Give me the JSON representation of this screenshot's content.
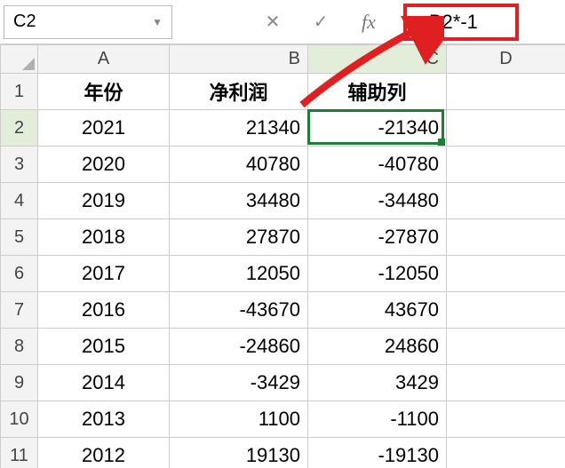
{
  "formulaBar": {
    "nameBox": "C2",
    "cancelIcon": "✕",
    "acceptIcon": "✓",
    "fxLabel": "fx",
    "formula": "=B2*-1"
  },
  "columns": [
    "A",
    "B",
    "C",
    "D"
  ],
  "headerRow": {
    "A": "年份",
    "B": "净利润",
    "C": "辅助列"
  },
  "rows": [
    {
      "n": "1",
      "A": "年份",
      "B": "净利润",
      "C": "辅助列",
      "D": "",
      "isHeader": true
    },
    {
      "n": "2",
      "A": "2021",
      "B": "21340",
      "C": "-21340",
      "D": ""
    },
    {
      "n": "3",
      "A": "2020",
      "B": "40780",
      "C": "-40780",
      "D": ""
    },
    {
      "n": "4",
      "A": "2019",
      "B": "34480",
      "C": "-34480",
      "D": ""
    },
    {
      "n": "5",
      "A": "2018",
      "B": "27870",
      "C": "-27870",
      "D": ""
    },
    {
      "n": "6",
      "A": "2017",
      "B": "12050",
      "C": "-12050",
      "D": ""
    },
    {
      "n": "7",
      "A": "2016",
      "B": "-43670",
      "C": "43670",
      "D": ""
    },
    {
      "n": "8",
      "A": "2015",
      "B": "-24860",
      "C": "24860",
      "D": ""
    },
    {
      "n": "9",
      "A": "2014",
      "B": "-3429",
      "C": "3429",
      "D": ""
    },
    {
      "n": "10",
      "A": "2013",
      "B": "1100",
      "C": "-1100",
      "D": ""
    },
    {
      "n": "11",
      "A": "2012",
      "B": "19130",
      "C": "-19130",
      "D": ""
    }
  ],
  "activeCell": {
    "row": 2,
    "col": "C"
  }
}
